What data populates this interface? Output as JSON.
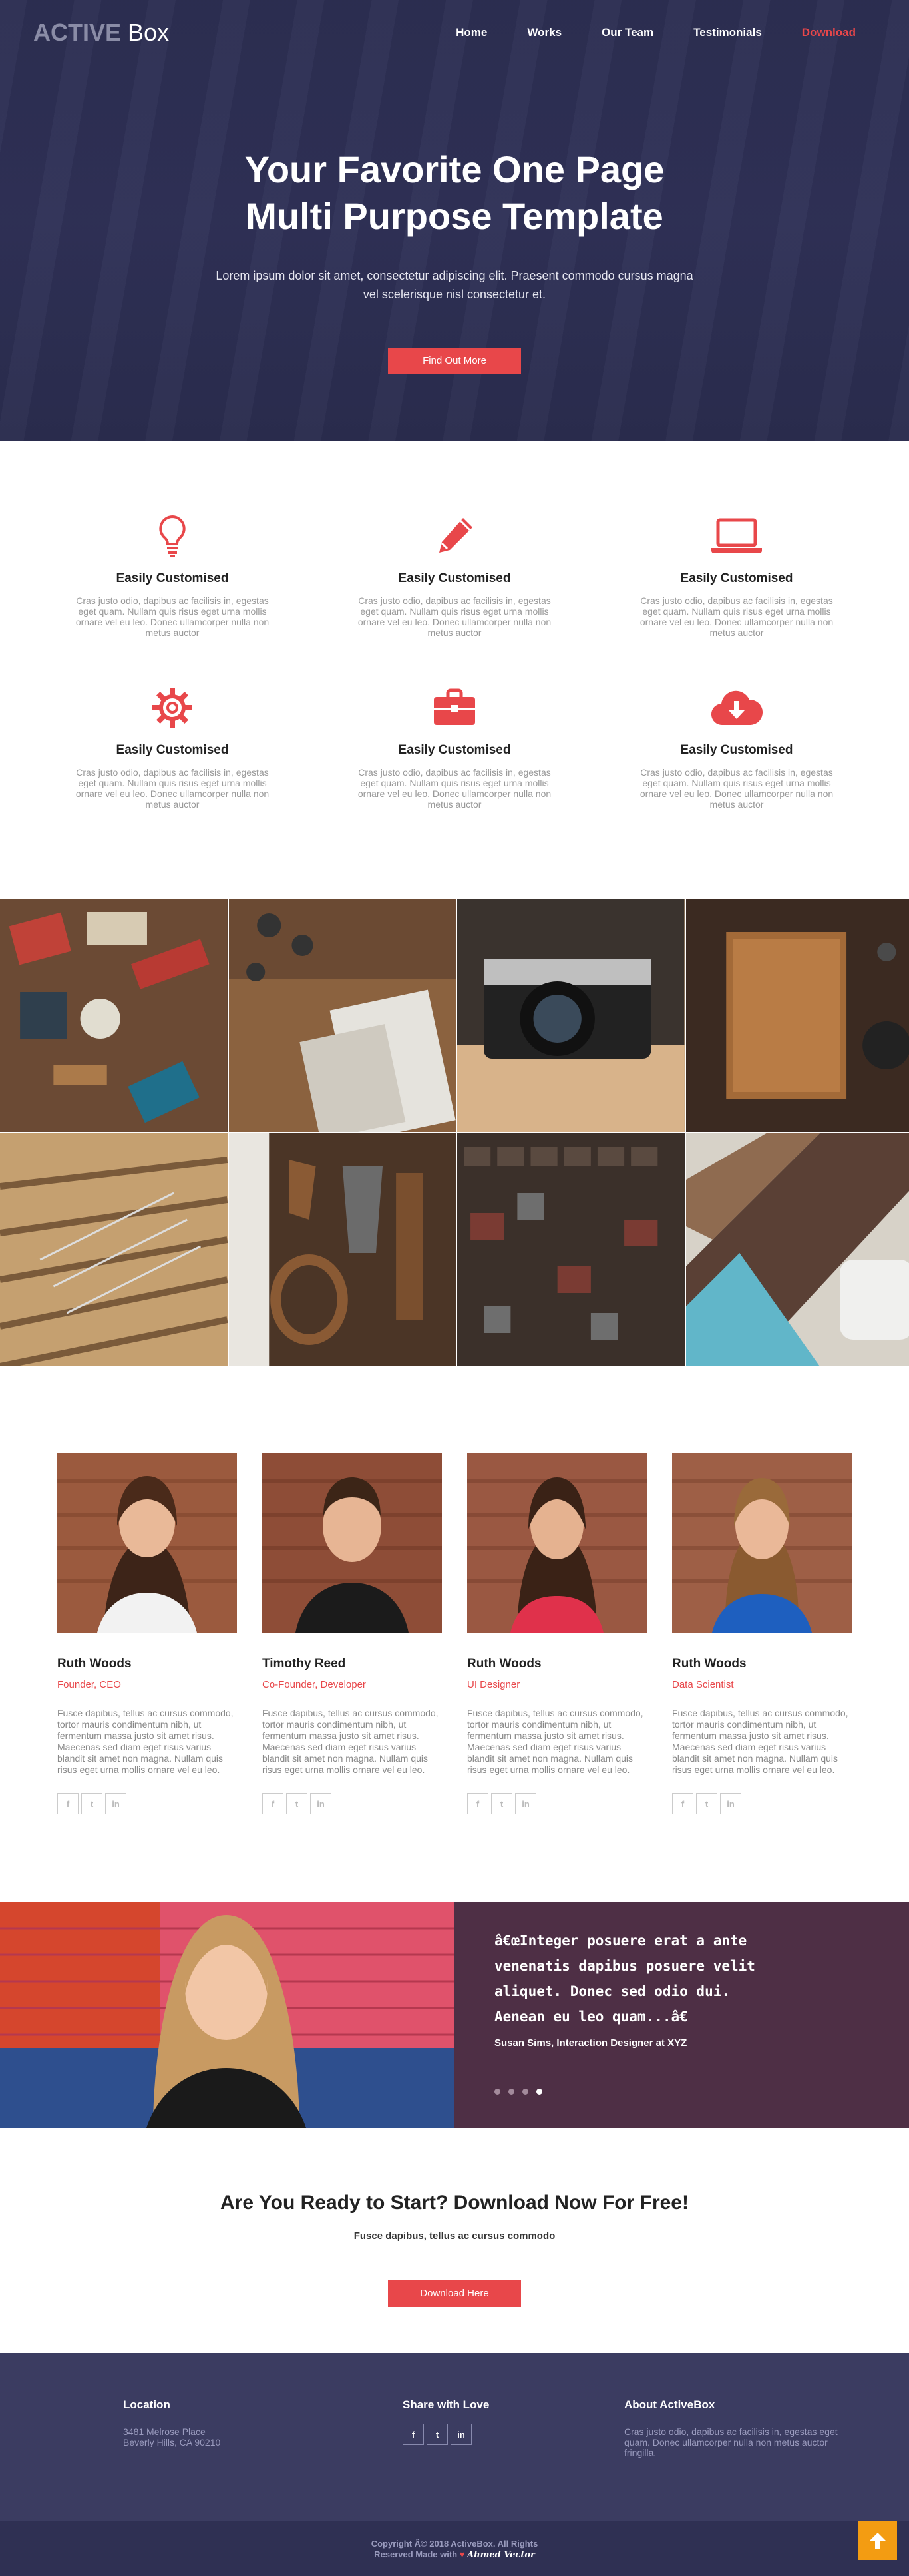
{
  "nav": {
    "logo_active": "ACTIVE",
    "logo_box": "Box",
    "links": [
      "Home",
      "Works",
      "Our Team",
      "Testimonials",
      "Download"
    ]
  },
  "hero": {
    "title_line1": "Your Favorite One Page",
    "title_line2": "Multi Purpose Template",
    "text": "Lorem ipsum dolor sit amet, consectetur adipiscing elit. Praesent commodo cursus magna vel scelerisque nisl consectetur et.",
    "button": "Find Out More"
  },
  "features": [
    {
      "icon": "lightbulb-icon",
      "title": "Easily Customised",
      "text": "Cras justo odio, dapibus ac facilisis in, egestas eget quam. Nullam quis risus eget urna mollis ornare vel eu leo. Donec ullamcorper nulla non metus auctor"
    },
    {
      "icon": "pencil-icon",
      "title": "Easily Customised",
      "text": "Cras justo odio, dapibus ac facilisis in, egestas eget quam. Nullam quis risus eget urna mollis ornare vel eu leo. Donec ullamcorper nulla non metus auctor"
    },
    {
      "icon": "laptop-icon",
      "title": "Easily Customised",
      "text": "Cras justo odio, dapibus ac facilisis in, egestas eget quam. Nullam quis risus eget urna mollis ornare vel eu leo. Donec ullamcorper nulla non metus auctor"
    },
    {
      "icon": "gear-icon",
      "title": "Easily Customised",
      "text": "Cras justo odio, dapibus ac facilisis in, egestas eget quam. Nullam quis risus eget urna mollis ornare vel eu leo. Donec ullamcorper nulla non metus auctor"
    },
    {
      "icon": "briefcase-icon",
      "title": "Easily Customised",
      "text": "Cras justo odio, dapibus ac facilisis in, egestas eget quam. Nullam quis risus eget urna mollis ornare vel eu leo. Donec ullamcorper nulla non metus auctor"
    },
    {
      "icon": "cloud-download-icon",
      "title": "Easily Customised",
      "text": "Cras justo odio, dapibus ac facilisis in, egestas eget quam. Nullam quis risus eget urna mollis ornare vel eu leo. Donec ullamcorper nulla non metus auctor"
    }
  ],
  "team": [
    {
      "name": "Ruth Woods",
      "role": "Founder, CEO",
      "bio": "Fusce dapibus, tellus ac cursus commodo, tortor mauris condimentum nibh, ut fermentum massa justo sit amet risus. Maecenas sed diam eget risus varius blandit sit amet non magna. Nullam quis risus eget urna mollis ornare vel eu leo."
    },
    {
      "name": "Timothy Reed",
      "role": "Co-Founder, Developer",
      "bio": "Fusce dapibus, tellus ac cursus commodo, tortor mauris condimentum nibh, ut fermentum massa justo sit amet risus. Maecenas sed diam eget risus varius blandit sit amet non magna. Nullam quis risus eget urna mollis ornare vel eu leo."
    },
    {
      "name": "Ruth Woods",
      "role": "UI Designer",
      "bio": "Fusce dapibus, tellus ac cursus commodo, tortor mauris condimentum nibh, ut fermentum massa justo sit amet risus. Maecenas sed diam eget risus varius blandit sit amet non magna. Nullam quis risus eget urna mollis ornare vel eu leo."
    },
    {
      "name": "Ruth Woods",
      "role": "Data Scientist",
      "bio": "Fusce dapibus, tellus ac cursus commodo, tortor mauris condimentum nibh, ut fermentum massa justo sit amet risus. Maecenas sed diam eget risus varius blandit sit amet non magna. Nullam quis risus eget urna mollis ornare vel eu leo."
    }
  ],
  "social_glyphs": {
    "facebook": "f",
    "twitter": "t",
    "linkedin": "in"
  },
  "testimonial": {
    "quote": "â€œInteger posuere erat a ante venenatis dapibus posuere velit aliquet. Donec sed odio dui. Aenean eu leo quam...â€",
    "author": "Susan Sims, Interaction Designer at XYZ"
  },
  "cta": {
    "title": "Are You Ready to Start? Download Now For Free!",
    "subtitle": "Fusce dapibus, tellus ac cursus commodo",
    "button": "Download Here"
  },
  "footer": {
    "location_title": "Location",
    "address_line1": "3481 Melrose Place",
    "address_line2": "Beverly Hills, CA 90210",
    "share_title": "Share with Love",
    "about_title": "About ActiveBox",
    "about_text": "Cras justo odio, dapibus ac facilisis in, egestas eget quam. Donec ullamcorper nulla non metus auctor fringilla.",
    "copyright": "Copyright Â© 2018 ActiveBox. All Rights",
    "made_with": "Reserved Made with",
    "made_by": "Ahmed Vector"
  },
  "colors": {
    "accent": "#e8474a",
    "hero_bg": "#2e3055",
    "footer_bg": "#3b3c61",
    "testimonial_bg": "#4e2f45",
    "to_top": "#f39c12"
  }
}
